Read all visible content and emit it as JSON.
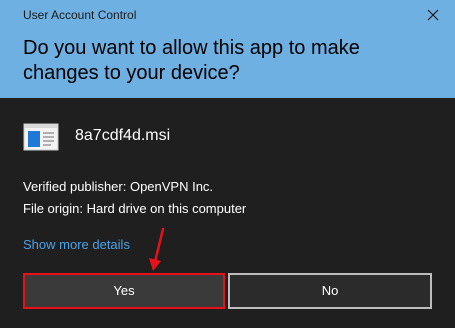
{
  "window": {
    "title": "User Account Control"
  },
  "prompt": {
    "question": "Do you want to allow this app to make changes to your device?"
  },
  "app": {
    "icon": "installer-package-icon",
    "name": "8a7cdf4d.msi"
  },
  "details": {
    "publisher": "Verified publisher: OpenVPN Inc.",
    "origin": "File origin: Hard drive on this computer",
    "show_more": "Show more details"
  },
  "buttons": {
    "yes": "Yes",
    "no": "No"
  },
  "colors": {
    "header_bg": "#6fb0e3",
    "body_bg": "#1f1f1f",
    "link": "#4aa3e8",
    "highlight": "#e8111a"
  },
  "annotation": {
    "arrow_icon": "red-arrow-pointing-to-yes"
  }
}
